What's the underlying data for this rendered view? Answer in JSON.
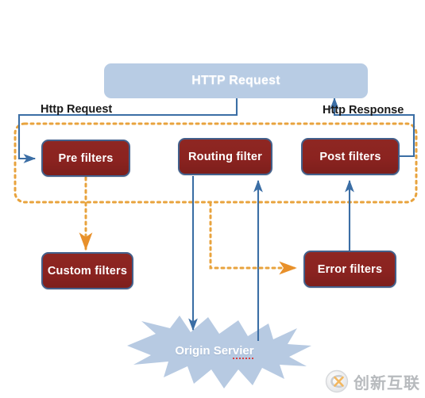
{
  "diagram": {
    "title": "HTTP Request",
    "background_color": "#ffffff",
    "colors": {
      "http_box_fill": "#b8cce4",
      "filter_box_fill": "#8b2320",
      "filter_box_border": "#43608b",
      "blue_line": "#3b6ea5",
      "orange_dotted": "#e8a33d",
      "star_fill": "#b3c7e0",
      "label_text": "#1a1a1a",
      "node_text": "#ffffff"
    }
  },
  "nodes": {
    "http_request_box": {
      "label": "HTTP Request"
    },
    "pre_filters": {
      "label": "Pre filters"
    },
    "routing_filter": {
      "label": "Routing filter"
    },
    "post_filters": {
      "label": "Post filters"
    },
    "custom_filters": {
      "label": "Custom filters"
    },
    "error_filters": {
      "label": "Error filters"
    },
    "origin_server": {
      "label_main": "Origin  Ser",
      "label_misspelled": "vier",
      "label_full": "Origin  Servier"
    }
  },
  "labels": {
    "http_request_flow": "Http Request",
    "http_response_flow": "Http Response"
  },
  "watermark": {
    "text": "创新互联",
    "logo_icon": "circle-logo-icon"
  },
  "connections": [
    {
      "name": "request-in-to-pre-filters",
      "style": "solid",
      "color": "#3b6ea5",
      "from": "http_request_box",
      "to": "pre_filters"
    },
    {
      "name": "post-filters-to-response-out",
      "style": "solid",
      "color": "#3b6ea5",
      "from": "post_filters",
      "to": "http_request_box"
    },
    {
      "name": "routing-filter-to-origin-server",
      "style": "solid",
      "color": "#3b6ea5",
      "from": "routing_filter",
      "to": "origin_server"
    },
    {
      "name": "origin-server-to-post-filters",
      "style": "solid",
      "color": "#3b6ea5",
      "from": "origin_server",
      "to": "post_filters"
    },
    {
      "name": "error-filters-to-post-filters",
      "style": "solid",
      "color": "#3b6ea5",
      "from": "error_filters",
      "to": "post_filters"
    },
    {
      "name": "pre-filters-to-custom-filters",
      "style": "dotted",
      "color": "#e8a33d",
      "from": "pre_filters",
      "to": "custom_filters"
    },
    {
      "name": "filter-chain-to-error-filters",
      "style": "dotted",
      "color": "#e8a33d",
      "from": "filter_chain",
      "to": "error_filters"
    }
  ]
}
